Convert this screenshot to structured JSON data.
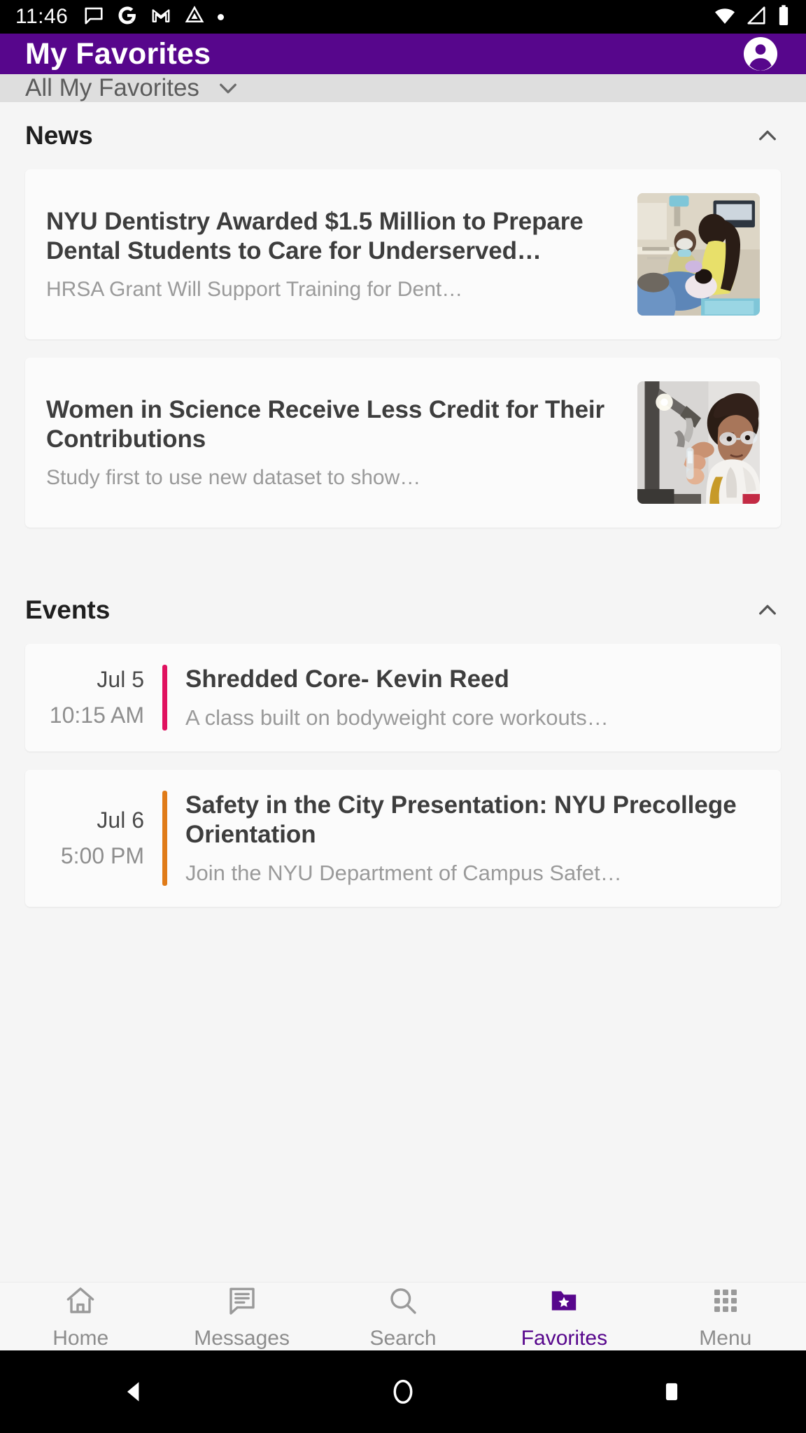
{
  "status_bar": {
    "time": "11:46",
    "left_icons": [
      "messages-icon",
      "google-icon",
      "gmail-icon",
      "drive-icon",
      "dot-indicator"
    ],
    "right_icons": [
      "wifi-icon",
      "cellular-signal-icon",
      "battery-icon"
    ]
  },
  "app_bar": {
    "title": "My Favorites",
    "account_icon": "account-circle-icon",
    "background_color": "#57068c"
  },
  "filter_bar": {
    "selected": "All My Favorites",
    "caret_icon": "chevron-down-icon",
    "background_color": "#dedede"
  },
  "sections": [
    {
      "title": "News",
      "collapse_icon": "chevron-up-icon",
      "expanded": true,
      "items": [
        {
          "title": "NYU Dentistry Awarded $1.5 Million to Prepare Dental Students to Care for Underserved…",
          "subtitle": "HRSA Grant Will Support Training for Dent…",
          "thumbnail": "dental-clinic-photo"
        },
        {
          "title": "Women in Science Receive Less Credit for Their Contributions",
          "subtitle": "Study first to use new dataset to show…",
          "thumbnail": "woman-scientist-lab-photo"
        }
      ]
    },
    {
      "title": "Events",
      "collapse_icon": "chevron-up-icon",
      "expanded": true,
      "items": [
        {
          "date": "Jul 5",
          "time": "10:15 AM",
          "title": "Shredded Core- Kevin Reed",
          "description": "A class built on bodyweight core workouts…",
          "accent_color": "#e0115f"
        },
        {
          "date": "Jul 6",
          "time": "5:00 PM",
          "title": "Safety in the City Presentation: NYU Precollege Orientation",
          "description": "Join the NYU Department of Campus Safet…",
          "accent_color": "#e07b18"
        }
      ]
    }
  ],
  "tab_bar": {
    "active_color": "#57068c",
    "inactive_color": "#8d8d8d",
    "tabs": [
      {
        "label": "Home",
        "icon": "home-icon",
        "active": false
      },
      {
        "label": "Messages",
        "icon": "messages-icon",
        "active": false
      },
      {
        "label": "Search",
        "icon": "search-icon",
        "active": false
      },
      {
        "label": "Favorites",
        "icon": "favorites-folder-star-icon",
        "active": true
      },
      {
        "label": "Menu",
        "icon": "grid-menu-icon",
        "active": false
      }
    ]
  },
  "nav_bar": {
    "buttons": [
      "back-button",
      "home-button",
      "recents-button"
    ]
  }
}
